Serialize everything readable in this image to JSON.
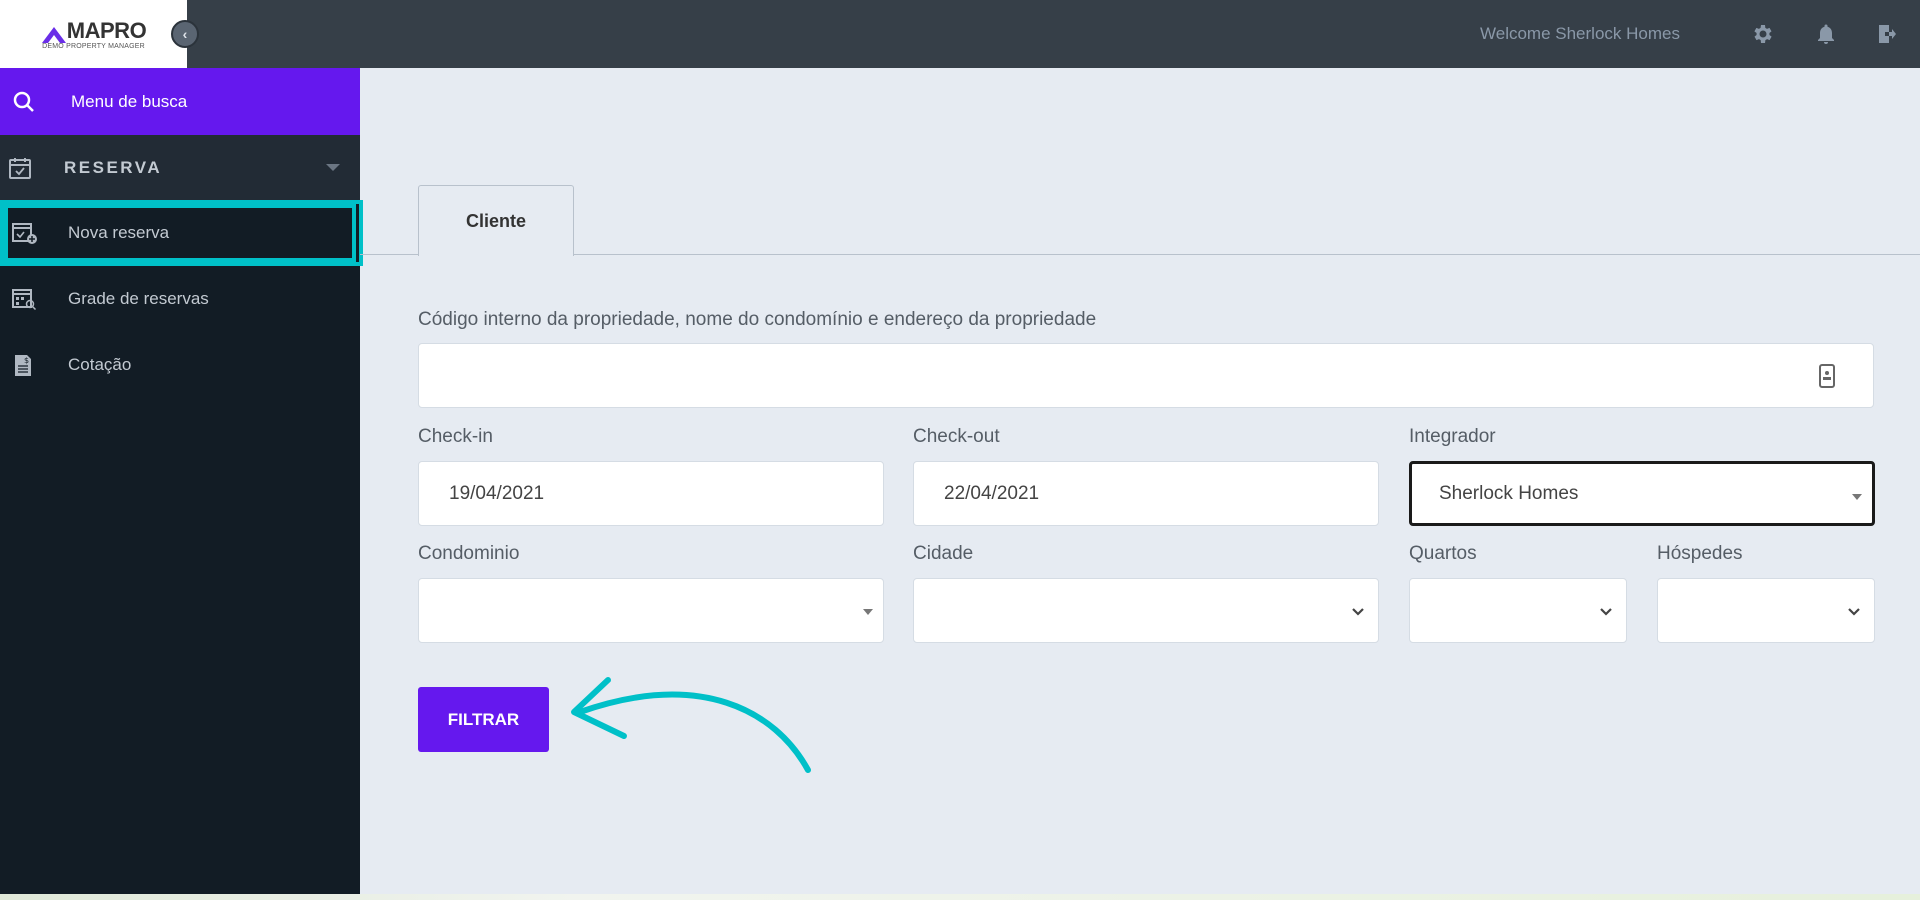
{
  "header": {
    "logo_text": "MAPRO",
    "logo_subtitle": "DEMO PROPERTY MANAGER",
    "welcome": "Welcome Sherlock Homes",
    "icons": [
      "gear-icon",
      "bell-icon",
      "logout-icon"
    ]
  },
  "sidebar": {
    "search_label": "Menu de busca",
    "group_label": "RESERVA",
    "items": [
      {
        "label": "Nova reserva",
        "active": true
      },
      {
        "label": "Grade de reservas"
      },
      {
        "label": "Cotação"
      }
    ]
  },
  "tabs": [
    {
      "label": "Cliente"
    }
  ],
  "form": {
    "property_label": "Código interno da propriedade, nome do condomínio e endereço da propriedade",
    "property_value": "",
    "checkin_label": "Check-in",
    "checkin_value": "19/04/2021",
    "checkout_label": "Check-out",
    "checkout_value": "22/04/2021",
    "integrador_label": "Integrador",
    "integrador_value": "Sherlock Homes",
    "condominio_label": "Condominio",
    "cidade_label": "Cidade",
    "quartos_label": "Quartos",
    "hospedes_label": "Hóspedes",
    "filter_button": "FILTRAR"
  },
  "colors": {
    "accent": "#6518ee",
    "highlight": "#00c0c8",
    "sidebar": "#121c25",
    "header": "#363f48"
  }
}
